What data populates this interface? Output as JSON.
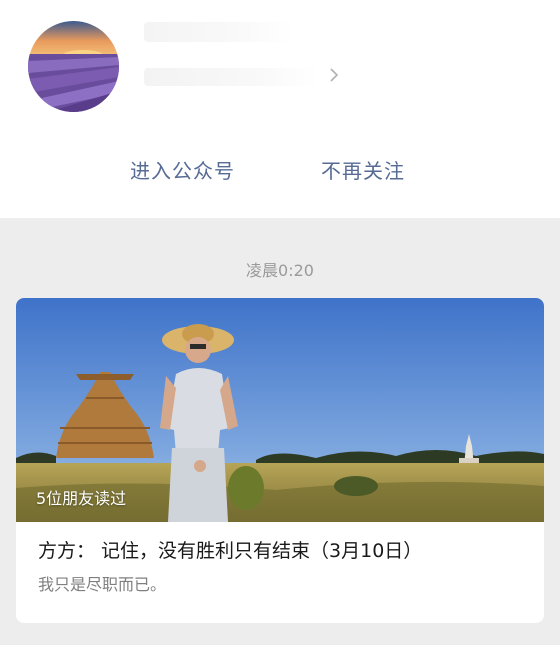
{
  "account": {
    "avatar_icon": "lavender-field-avatar",
    "chevron_icon": "chevron-right-icon"
  },
  "actions": {
    "enter_label": "进入公众号",
    "unfollow_label": "不再关注"
  },
  "message": {
    "time": "凌晨0:20",
    "readers_badge": "5位朋友读过",
    "title": "方方： 记住，没有胜利只有结束（3月10日）",
    "digest": "我只是尽职而已。"
  },
  "colors": {
    "link": "#576b95",
    "background": "#ededed"
  }
}
